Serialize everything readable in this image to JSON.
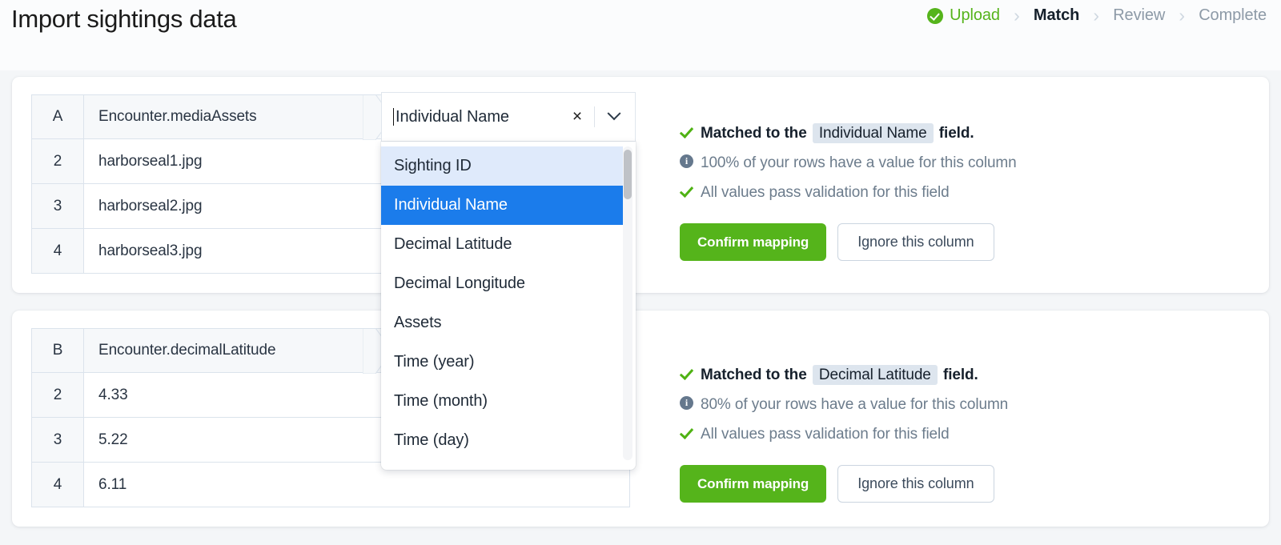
{
  "header": {
    "title": "Import sightings data",
    "steps": [
      {
        "label": "Upload",
        "state": "done",
        "icon": "check-circle-icon"
      },
      {
        "label": "Match",
        "state": "active",
        "icon": ""
      },
      {
        "label": "Review",
        "state": "todo",
        "icon": ""
      },
      {
        "label": "Complete",
        "state": "todo",
        "icon": ""
      }
    ],
    "separator": "›"
  },
  "colors": {
    "green": "#55b41b",
    "blue_selected": "#1b7ceb",
    "blue_hover": "#dfeafb",
    "chip": "#dde5ee",
    "muted_text": "#6c7c8c"
  },
  "combobox": {
    "value": "Individual Name",
    "clear_label": "×",
    "chevron_icon": "chevron-down-icon",
    "clear_icon": "close-icon",
    "options": [
      "Sighting ID",
      "Individual Name",
      "Decimal Latitude",
      "Decimal Longitude",
      "Assets",
      "Time (year)",
      "Time (month)",
      "Time (day)"
    ],
    "hovered_option": "Sighting ID",
    "selected_option": "Individual Name"
  },
  "cards": [
    {
      "table": {
        "column_letter": "A",
        "column_header": "Encounter.mediaAssets",
        "rows": [
          {
            "num": "2",
            "value": "harborseal1.jpg"
          },
          {
            "num": "3",
            "value": "harborseal2.jpg"
          },
          {
            "num": "4",
            "value": "harborseal3.jpg"
          }
        ]
      },
      "status": {
        "matched_prefix": "Matched to the",
        "matched_field": "Individual Name",
        "matched_suffix": "field.",
        "coverage": "100% of your rows have a value for this column",
        "validation": "All values pass validation for this field"
      },
      "buttons": {
        "confirm": "Confirm mapping",
        "ignore": "Ignore this column"
      }
    },
    {
      "table": {
        "column_letter": "B",
        "column_header": "Encounter.decimalLatitude",
        "rows": [
          {
            "num": "2",
            "value": "4.33"
          },
          {
            "num": "3",
            "value": "5.22"
          },
          {
            "num": "4",
            "value": "6.11"
          }
        ]
      },
      "status": {
        "matched_prefix": "Matched to the",
        "matched_field": "Decimal Latitude",
        "matched_suffix": "field.",
        "coverage": "80% of your rows have a value for this column",
        "validation": "All values pass validation for this field"
      },
      "buttons": {
        "confirm": "Confirm mapping",
        "ignore": "Ignore this column"
      }
    }
  ]
}
